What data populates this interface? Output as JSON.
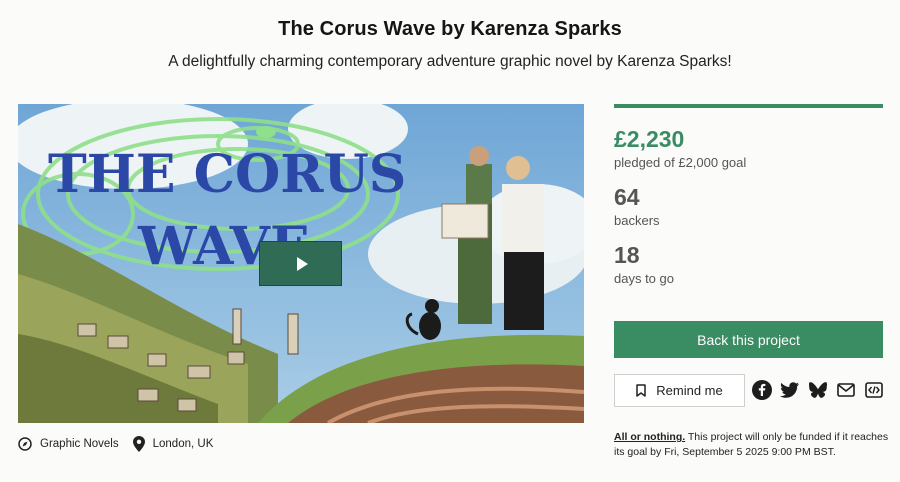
{
  "header": {
    "title": "The Corus Wave by Karenza Sparks",
    "subtitle": "A delightfully charming contemporary adventure graphic novel by Karenza Sparks!"
  },
  "video": {
    "thumbnail_text_line1": "THE CORUS",
    "thumbnail_text_line2": "WAVE",
    "play_icon": "play-icon"
  },
  "categories": [
    {
      "icon": "compass-icon",
      "label": "Graphic Novels"
    },
    {
      "icon": "location-pin-icon",
      "label": "London, UK"
    }
  ],
  "stats": {
    "progress_fraction": 1.0,
    "pledged": "£2,230",
    "pledged_label": "pledged of £2,000 goal",
    "backers": "64",
    "backers_label": "backers",
    "days": "18",
    "days_label": "days to go"
  },
  "actions": {
    "back_label": "Back this project",
    "remind_label": "Remind me",
    "remind_icon": "bookmark-icon",
    "social": [
      "facebook-icon",
      "twitter-icon",
      "bluesky-icon",
      "email-icon",
      "embed-icon"
    ]
  },
  "funding_note": {
    "link": "All or nothing.",
    "text": " This project will only be funded if it reaches its goal by Fri, September 5 2025 9:00 PM BST."
  },
  "colors": {
    "accent": "#3a8c63",
    "play_button": "#2f6b55"
  }
}
